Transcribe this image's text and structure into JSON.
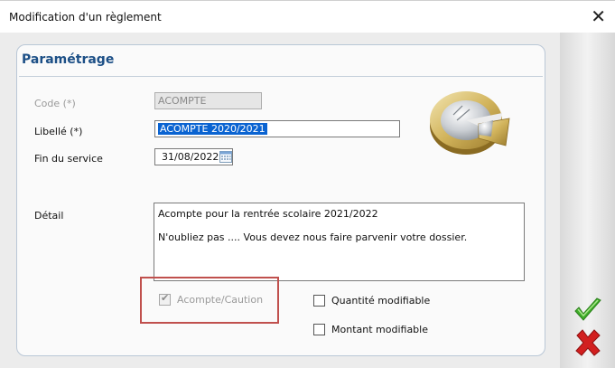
{
  "window": {
    "title": "Modification d'un règlement",
    "close_glyph": "✕"
  },
  "panel": {
    "title": "Paramétrage"
  },
  "form": {
    "code": {
      "label": "Code (*)",
      "value": "ACOMPTE",
      "disabled": true
    },
    "libelle": {
      "label": "Libellé (*)",
      "value": "ACOMPTE 2020/2021"
    },
    "fin_service": {
      "label": "Fin du service",
      "value": "31/08/2022"
    },
    "detail": {
      "label": "Détail",
      "lines": [
        "Acompte pour la rentrée scolaire 2021/2022",
        "N'oubliez pas .... Vous devez nous faire parvenir votre dossier."
      ]
    }
  },
  "checkboxes": {
    "acompte_caution": {
      "label": "Acompte/Caution",
      "checked": true,
      "disabled": true
    },
    "quantite_modifiable": {
      "label": "Quantité modifiable",
      "checked": false
    },
    "montant_modifiable": {
      "label": "Montant modifiable",
      "checked": false
    }
  },
  "actions": {
    "ok_icon": "green-check-icon",
    "cancel_icon": "red-x-icon"
  },
  "colors": {
    "accent": "#1c4f86",
    "selection": "#0a63d1",
    "highlight": "#c0504d",
    "ok": "#3fae2a",
    "cancel": "#d21f1f"
  }
}
